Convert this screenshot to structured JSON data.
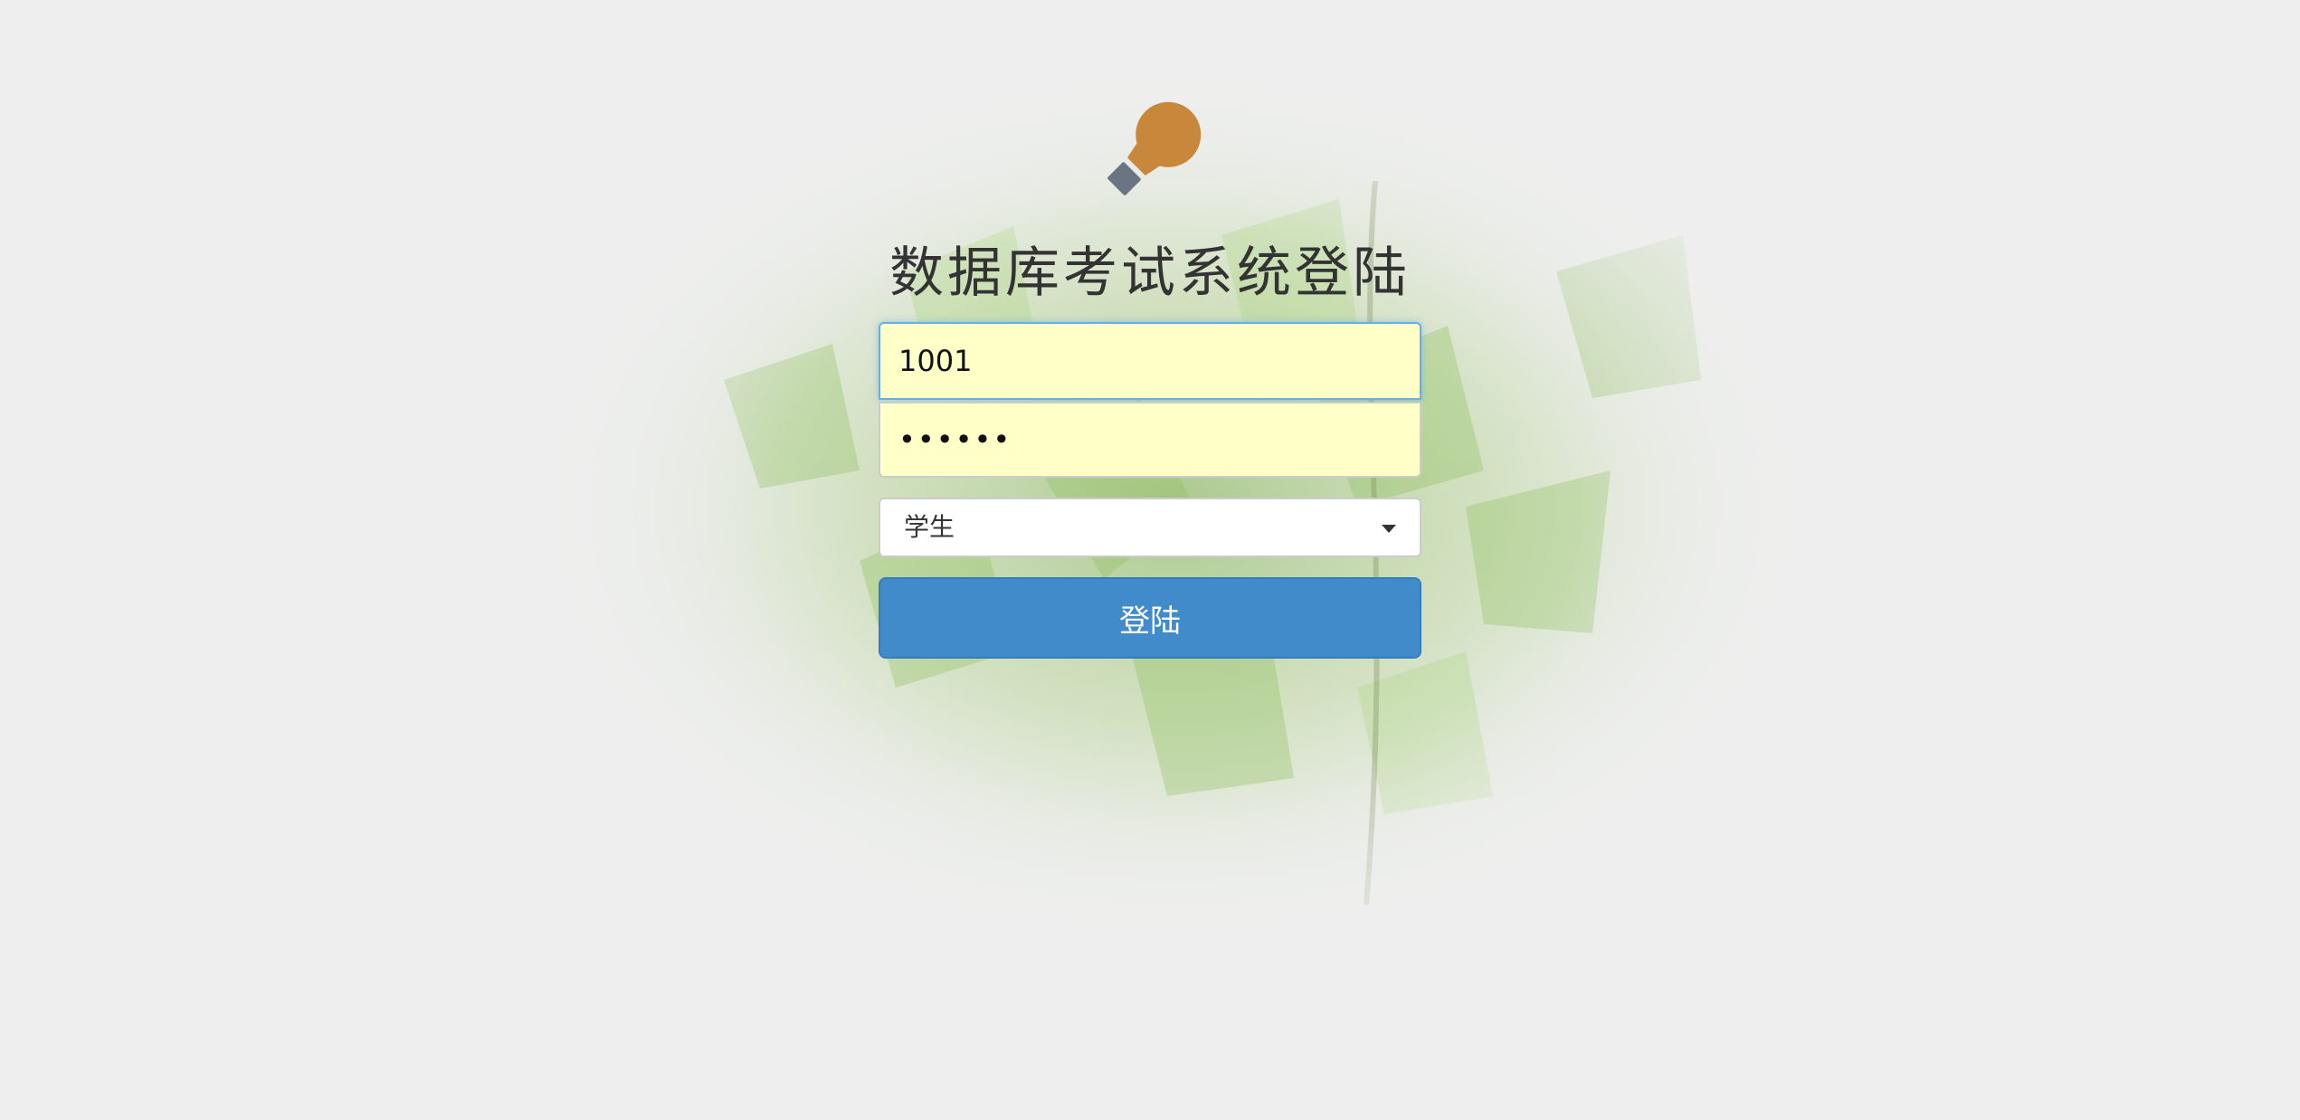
{
  "colors": {
    "background": "#eeeeee",
    "logo_bulb": "#c8873b",
    "logo_base": "#6b7482",
    "title_text": "#333333",
    "input_fill": "#ffffc8",
    "focus_border": "#66afe9",
    "button": "#428bca",
    "button_text": "#ffffff"
  },
  "logo": {
    "icon": "lightbulb-icon"
  },
  "title": "数据库考试系统登陆",
  "username": {
    "value": "1001"
  },
  "password": {
    "value": "••••••"
  },
  "role": {
    "selected": "学生",
    "icon": "caret-down-icon"
  },
  "login_button": {
    "label": "登陆"
  }
}
